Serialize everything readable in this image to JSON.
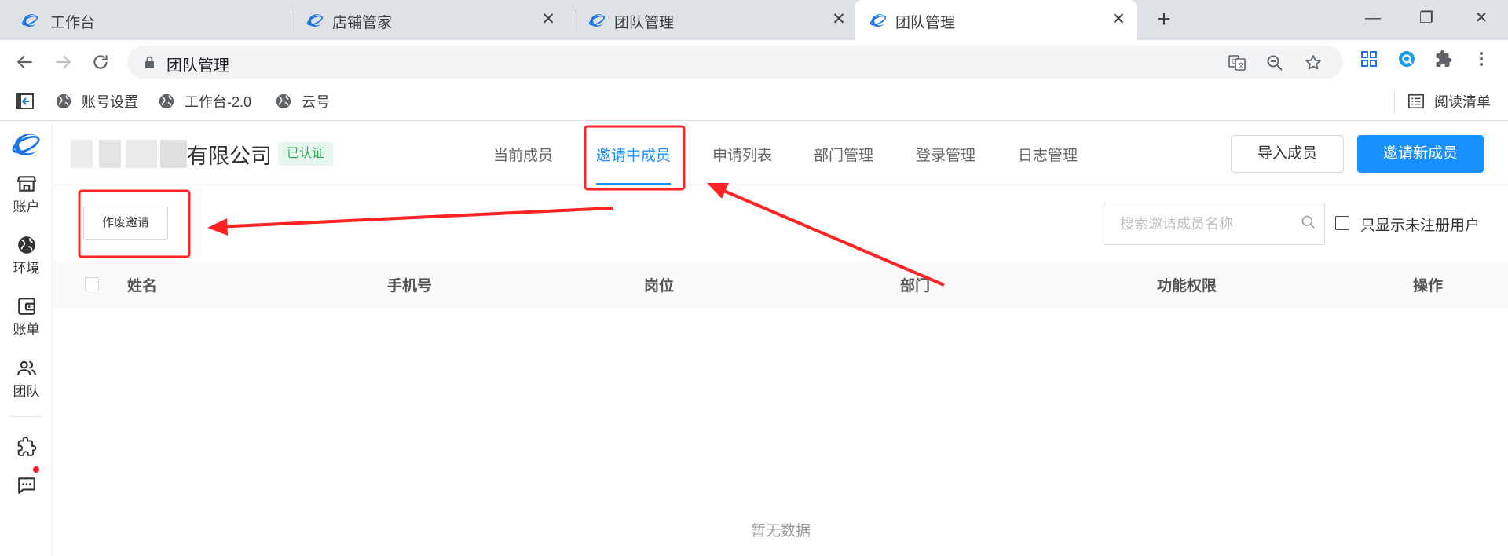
{
  "browser": {
    "tabs": [
      {
        "title": "工作台"
      },
      {
        "title": "店铺管家",
        "close": "✕"
      },
      {
        "title": "团队管理",
        "close": "✕"
      },
      {
        "title": "团队管理",
        "close": "✕",
        "active": true
      }
    ],
    "new_tab": "+",
    "window": {
      "minimize": "—",
      "restore": "❐",
      "close": "✕"
    },
    "address": "团队管理",
    "bookmarks": [
      {
        "label": "账号设置"
      },
      {
        "label": "工作台-2.0"
      },
      {
        "label": "云号"
      }
    ],
    "reading_list": "阅读清单"
  },
  "sidebar": {
    "items": [
      {
        "label": "账户",
        "icon": "store-icon"
      },
      {
        "label": "环境",
        "icon": "globe-icon"
      },
      {
        "label": "账单",
        "icon": "wallet-icon"
      },
      {
        "label": "团队",
        "icon": "team-icon"
      }
    ],
    "bottom_icons": [
      "puzzle-icon",
      "message-icon"
    ]
  },
  "header": {
    "company_suffix": "有限公司",
    "verified_badge": "已认证",
    "tabs": [
      "当前成员",
      "邀请中成员",
      "申请列表",
      "部门管理",
      "登录管理",
      "日志管理"
    ],
    "active_tab": "邀请中成员",
    "import_button": "导入成员",
    "invite_button": "邀请新成员"
  },
  "toolbar": {
    "void_button": "作废邀请",
    "search_placeholder": "搜索邀请成员名称",
    "checkbox_label": "只显示未注册用户"
  },
  "table": {
    "columns": [
      "姓名",
      "手机号",
      "岗位",
      "部门",
      "功能权限",
      "操作"
    ],
    "empty_text": "暂无数据"
  },
  "colors": {
    "primary": "#1890ff",
    "annotation": "#ff2323",
    "badge_text": "#35a35a",
    "badge_bg": "#e8f7ee"
  }
}
